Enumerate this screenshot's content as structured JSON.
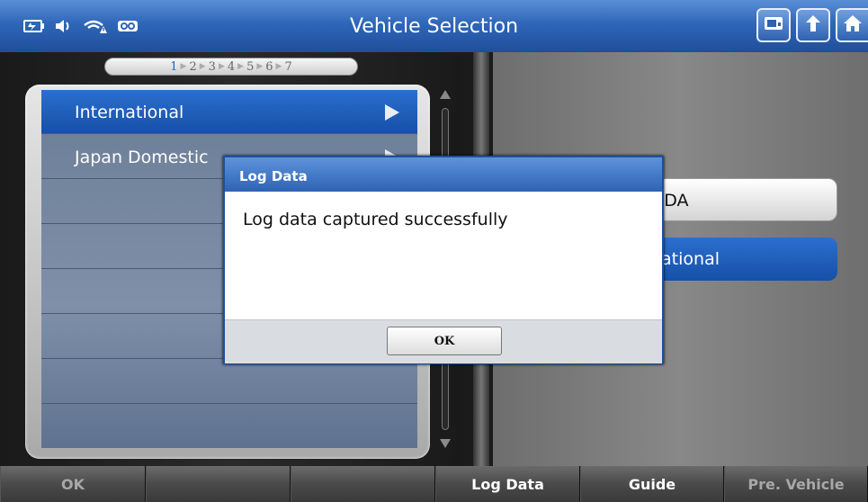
{
  "header": {
    "title": "Vehicle Selection",
    "status_icons": [
      "battery-icon",
      "speaker-icon",
      "wifi-warning-icon",
      "vci-icon"
    ],
    "buttons": [
      "screenshot-icon",
      "back-icon",
      "home-icon"
    ]
  },
  "steps": {
    "items": [
      "1",
      "2",
      "3",
      "4",
      "5",
      "6",
      "7"
    ],
    "current": "1"
  },
  "list": {
    "items": [
      {
        "label": "International",
        "selected": true
      },
      {
        "label": "Japan Domestic",
        "selected": false
      }
    ]
  },
  "right_panel": {
    "options": [
      {
        "label": "NDA"
      },
      {
        "label": "national"
      }
    ]
  },
  "dialog": {
    "title": "Log Data",
    "message": "Log data captured successfully",
    "ok_label": "OK"
  },
  "bottom_bar": {
    "buttons": [
      {
        "label": "OK",
        "enabled": false
      },
      {
        "label": "",
        "enabled": false
      },
      {
        "label": "",
        "enabled": false
      },
      {
        "label": "Log Data",
        "enabled": true
      },
      {
        "label": "Guide",
        "enabled": true
      },
      {
        "label": "Pre. Vehicle",
        "enabled": false
      }
    ]
  },
  "colors": {
    "header_blue": "#2f66b8",
    "selection_blue": "#1b5fbf",
    "list_bg": "#7586a0"
  }
}
